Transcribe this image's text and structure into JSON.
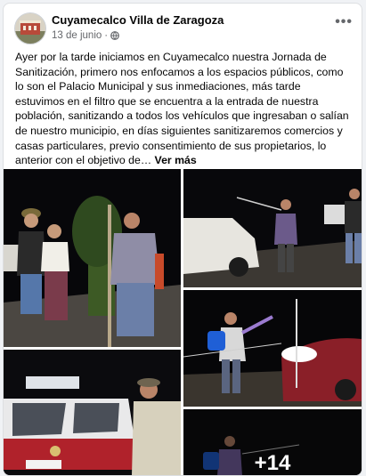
{
  "post": {
    "page_name": "Cuyamecalco Villa de Zaragoza",
    "date": "13 de junio",
    "meta_separator": "·",
    "more_options_label": "•••",
    "text": "Ayer por la tarde iniciamos en Cuyamecalco nuestra Jornada de Sanitización, primero nos enfocamos a los espacios públicos, como lo son el Palacio Municipal y sus inmediaciones, más tarde estuvimos en el filtro que se encuentra a la entrada de nuestra población, sanitizando a todos los vehículos que ingresaban o salían de nuestro municipio, en días siguientes sanitizaremos comercios y casas particulares, previo consentimiento de sus propietarios, lo anterior con el objetivo de… ",
    "see_more": "Ver más",
    "extra_photos": "+14"
  },
  "icons": {
    "privacy": "globe-icon",
    "options": "more-options-icon"
  },
  "colors": {
    "secondary_text": "#65676b",
    "card_border": "#dddfe2"
  }
}
